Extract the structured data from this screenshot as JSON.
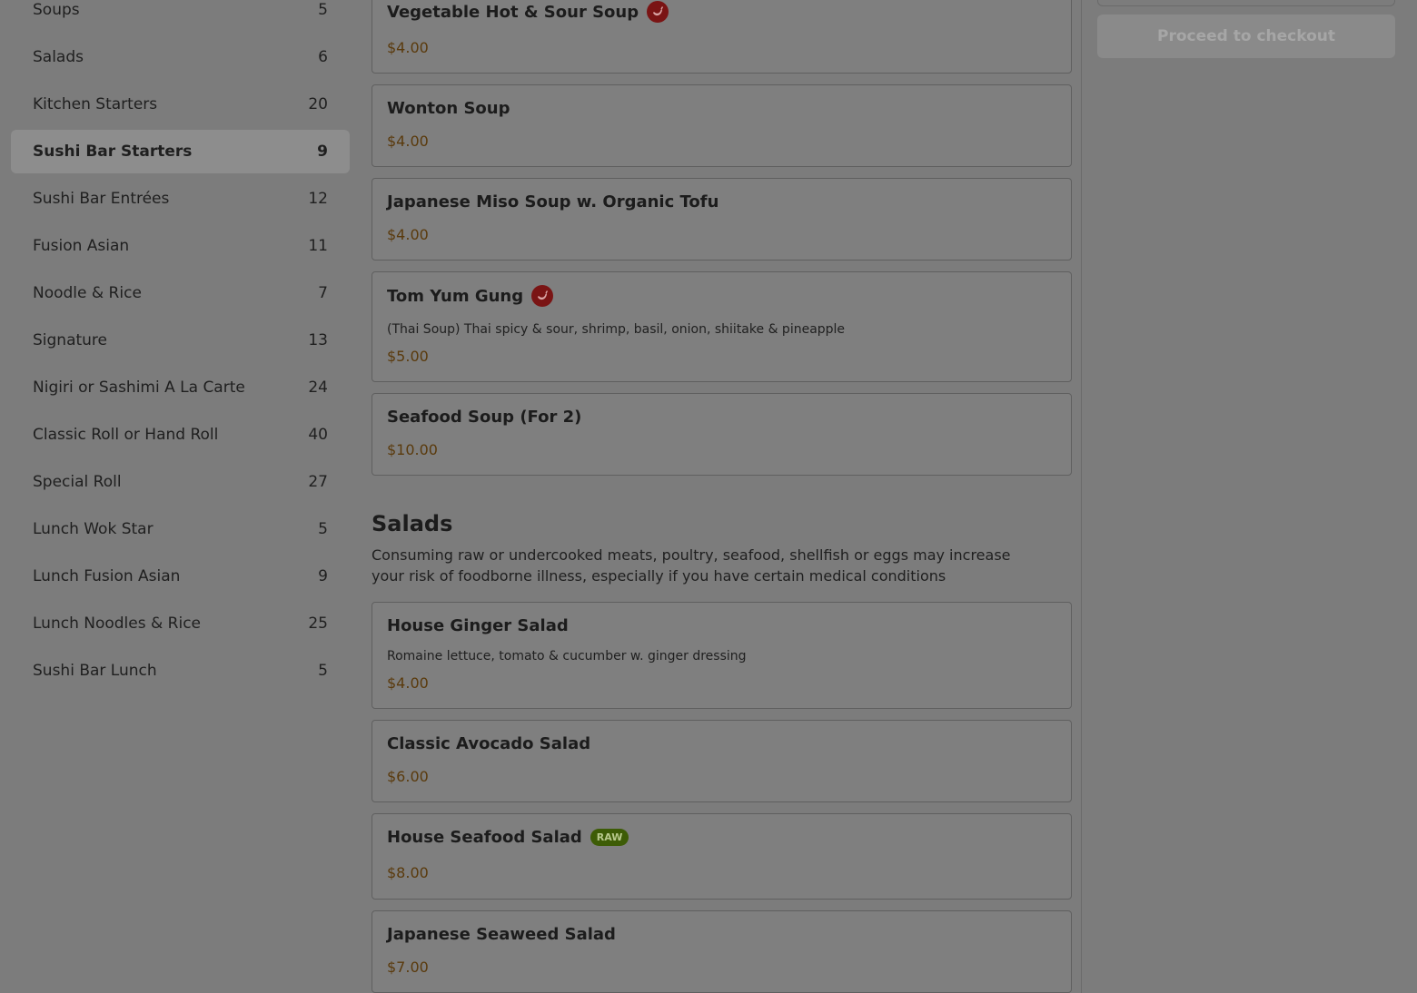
{
  "sidebar": {
    "categories": [
      {
        "label": "Soups",
        "count": "5"
      },
      {
        "label": "Salads",
        "count": "6"
      },
      {
        "label": "Kitchen Starters",
        "count": "20"
      },
      {
        "label": "Sushi Bar Starters",
        "count": "9",
        "active": true
      },
      {
        "label": "Sushi Bar Entrées",
        "count": "12"
      },
      {
        "label": "Fusion Asian",
        "count": "11"
      },
      {
        "label": "Noodle & Rice",
        "count": "7"
      },
      {
        "label": "Signature",
        "count": "13"
      },
      {
        "label": "Nigiri or Sashimi A La Carte",
        "count": "24"
      },
      {
        "label": "Classic Roll or Hand Roll",
        "count": "40"
      },
      {
        "label": "Special Roll",
        "count": "27"
      },
      {
        "label": "Lunch Wok Star",
        "count": "5"
      },
      {
        "label": "Lunch Fusion Asian",
        "count": "9"
      },
      {
        "label": "Lunch Noodles & Rice",
        "count": "25"
      },
      {
        "label": "Sushi Bar Lunch",
        "count": "5"
      }
    ]
  },
  "soups": {
    "items": [
      {
        "name": "Vegetable Hot & Sour Soup",
        "price": "$4.00",
        "icon": "chili-pepper-icon"
      },
      {
        "name": "Wonton Soup",
        "price": "$4.00"
      },
      {
        "name": "Japanese Miso Soup w. Organic Tofu",
        "price": "$4.00"
      },
      {
        "name": "Tom Yum Gung",
        "description": "(Thai Soup) Thai spicy & sour, shrimp, basil, onion, shiitake & pineapple",
        "price": "$5.00",
        "icon": "chili-pepper-icon"
      },
      {
        "name": "Seafood Soup (For 2)",
        "price": "$10.00"
      }
    ]
  },
  "salads": {
    "title": "Salads",
    "note": "Consuming raw or undercooked meats, poultry, seafood, shellfish or eggs may increase your risk of foodborne illness, especially if you have certain medical conditions",
    "items": [
      {
        "name": "House Ginger Salad",
        "description": "Romaine lettuce, tomato & cucumber w. ginger dressing",
        "price": "$4.00"
      },
      {
        "name": "Classic Avocado Salad",
        "price": "$6.00"
      },
      {
        "name": "House Seafood Salad",
        "badge": "RAW",
        "price": "$8.00"
      },
      {
        "name": "Japanese Seaweed Salad",
        "price": "$7.00"
      }
    ]
  },
  "cart": {
    "checkout_label": "Proceed to checkout"
  },
  "colors": {
    "overlay_bg": "#7c7c7c",
    "price": "#5a3a0c",
    "chili": "#7a1414",
    "raw_badge": "#3d5c06"
  }
}
